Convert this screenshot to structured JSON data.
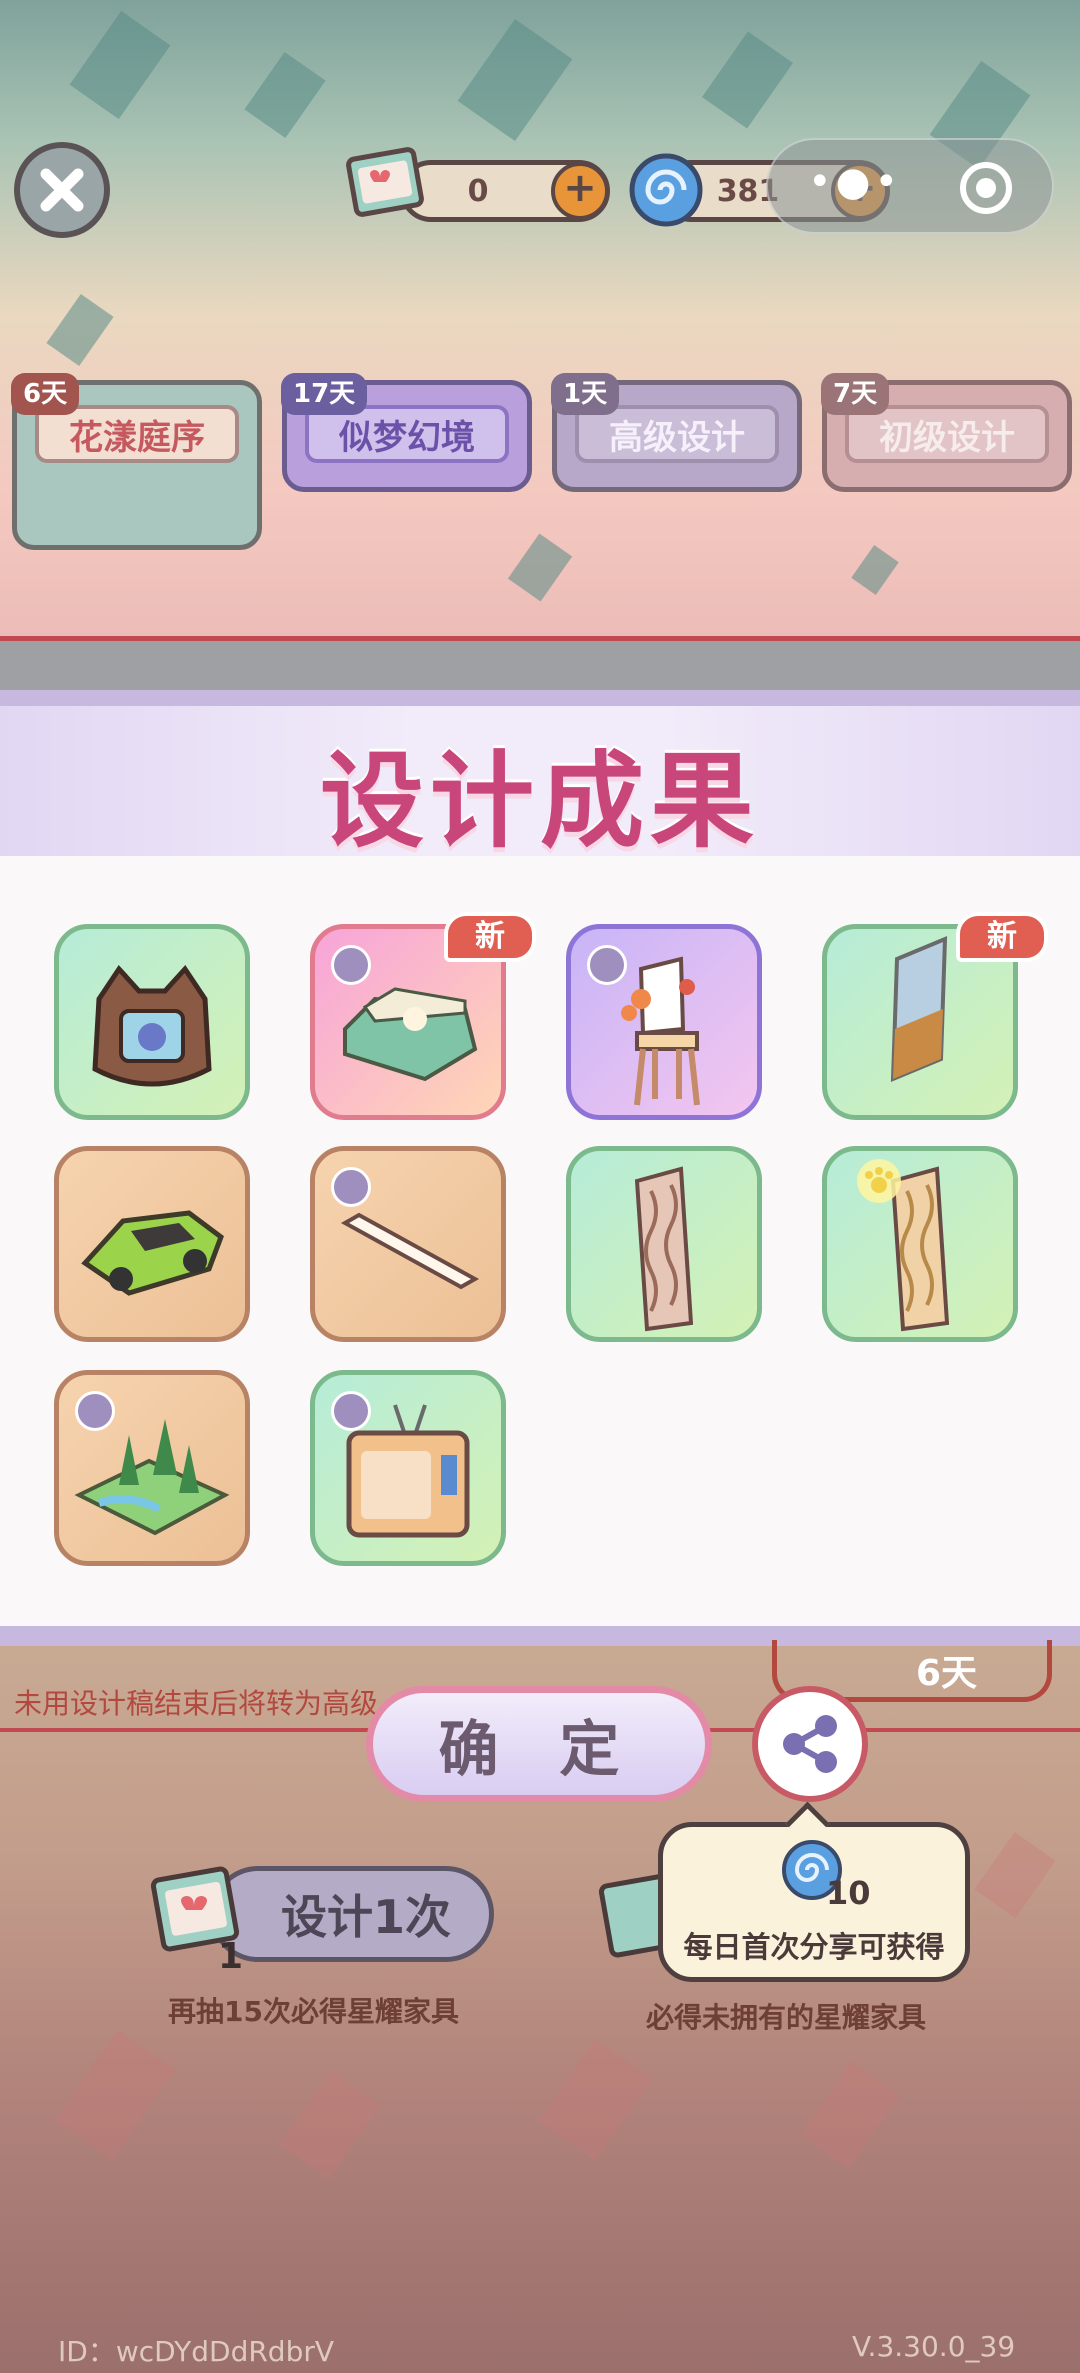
{
  "top_bar": {
    "ticket_count": "0",
    "swirl_count": "381",
    "colors": {
      "plus": "#e8953a",
      "pill": "#e9dcc9"
    }
  },
  "tabs": [
    {
      "label": "花漾庭序",
      "days": "6天"
    },
    {
      "label": "似梦幻境",
      "days": "17天"
    },
    {
      "label": "高级设计",
      "days": "1天"
    },
    {
      "label": "初级设计",
      "days": "7天"
    }
  ],
  "panel": {
    "title": "设计成果",
    "new_badge": "新",
    "items": [
      {
        "icon": "bear-frame-icon"
      },
      {
        "icon": "sofa-icon",
        "is_new": true
      },
      {
        "icon": "flower-chair-icon"
      },
      {
        "icon": "mirror-panel-icon",
        "is_new": true
      },
      {
        "icon": "green-car-icon"
      },
      {
        "icon": "white-plank-icon"
      },
      {
        "icon": "lattice-screen-icon"
      },
      {
        "icon": "lattice-screen-paw-icon"
      },
      {
        "icon": "forest-diorama-icon"
      },
      {
        "icon": "tv-icon"
      }
    ]
  },
  "bottom": {
    "scroll_text": "未用设计稿结束后将转为高级",
    "timer": "6天",
    "confirm_label": "确 定",
    "tooltip_count": "10",
    "tooltip_text": "每日首次分享可获得",
    "design_once_label": "设计1次",
    "ticket_qty": "1",
    "hint_left": "再抽15次必得星耀家具",
    "hint_right": "必得未拥有的星耀家具"
  },
  "footer": {
    "id": "ID：wcDYdDdRdbrV",
    "version": "V.3.30.0_39"
  }
}
